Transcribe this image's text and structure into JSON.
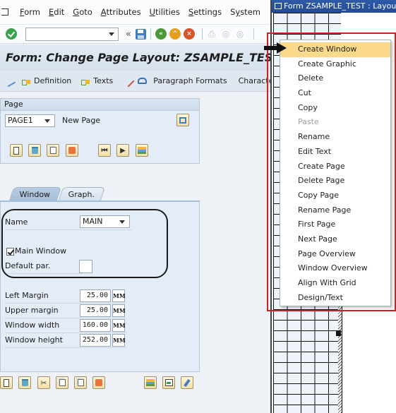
{
  "menubar": {
    "items": [
      {
        "label": "Form",
        "mnemonic": "F"
      },
      {
        "label": "Edit",
        "mnemonic": "E"
      },
      {
        "label": "Goto",
        "mnemonic": "G"
      },
      {
        "label": "Attributes",
        "mnemonic": "A"
      },
      {
        "label": "Utilities",
        "mnemonic": "U"
      },
      {
        "label": "Settings",
        "mnemonic": "S"
      },
      {
        "label": "System",
        "mnemonic": "y"
      }
    ]
  },
  "toolbar": {
    "command_field_value": "",
    "back_chevron": "«"
  },
  "title": "Form: Change Page Layout: ZSAMPLE_TEST",
  "app_toolbar": {
    "definition": "Definition",
    "texts": "Texts",
    "paragraph_formats": "Paragraph Formats",
    "character_formats": "Character Formats"
  },
  "page_group": {
    "header": "Page",
    "page_select": "PAGE1",
    "page_desc": "New Page"
  },
  "tabs": {
    "window": "Window",
    "graph": "Graph."
  },
  "window_group": {
    "name_label": "Name",
    "name_value": "MAIN",
    "main_window_label": "Main Window",
    "main_window_checked": true,
    "default_par_label": "Default par.",
    "default_par_value": "",
    "fields": [
      {
        "label": "Left Margin",
        "value": "25.00",
        "unit": "MM"
      },
      {
        "label": "Upper margin",
        "value": "25.00",
        "unit": "MM"
      },
      {
        "label": "Window width",
        "value": "160.00",
        "unit": "MM"
      },
      {
        "label": "Window height",
        "value": "252.00",
        "unit": "MM"
      }
    ]
  },
  "layout_window": {
    "title": "Form ZSAMPLE_TEST : Layout"
  },
  "context_menu": {
    "items": [
      {
        "label": "Create Window",
        "state": "hover"
      },
      {
        "label": "Create Graphic",
        "state": "normal"
      },
      {
        "label": "Delete",
        "state": "normal"
      },
      {
        "label": "Cut",
        "state": "normal"
      },
      {
        "label": "Copy",
        "state": "normal"
      },
      {
        "label": "Paste",
        "state": "disabled"
      },
      {
        "label": "Rename",
        "state": "normal"
      },
      {
        "label": "Edit Text",
        "state": "normal"
      },
      {
        "label": "Create Page",
        "state": "normal"
      },
      {
        "label": "Delete Page",
        "state": "normal"
      },
      {
        "label": "Copy Page",
        "state": "normal"
      },
      {
        "label": "Rename Page",
        "state": "normal"
      },
      {
        "label": "First Page",
        "state": "normal"
      },
      {
        "label": "Next Page",
        "state": "normal"
      },
      {
        "label": "Page Overview",
        "state": "normal"
      },
      {
        "label": "Window Overview",
        "state": "normal"
      },
      {
        "label": "Align With Grid",
        "state": "normal"
      },
      {
        "label": "Design/Text",
        "state": "normal"
      }
    ]
  },
  "colors": {
    "highlight_frame": "#d31f1f",
    "menu_hover": "#fbd98a",
    "title_bar": "#2e5aa8"
  }
}
